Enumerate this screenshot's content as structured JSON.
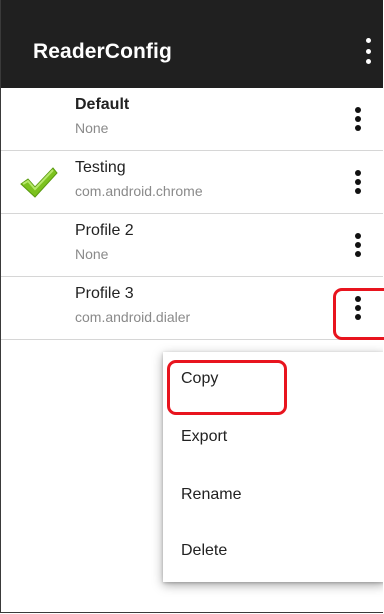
{
  "app": {
    "title": "ReaderConfig",
    "overflow_icon": "more-vert-icon"
  },
  "profiles": [
    {
      "name": "Default",
      "package": "None",
      "bold": true,
      "active": false
    },
    {
      "name": "Testing",
      "package": "com.android.chrome",
      "bold": false,
      "active": true
    },
    {
      "name": "Profile 2",
      "package": "None",
      "bold": false,
      "active": false
    },
    {
      "name": "Profile 3",
      "package": "com.android.dialer",
      "bold": false,
      "active": false
    }
  ],
  "context_menu": {
    "items": [
      "Copy",
      "Export",
      "Rename",
      "Delete"
    ]
  },
  "colors": {
    "toolbar": "#202020",
    "highlight": "#e8141e",
    "check": "#7cc21e"
  }
}
